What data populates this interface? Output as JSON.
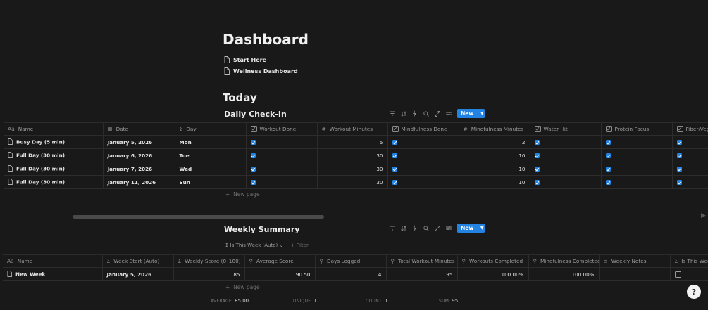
{
  "page": {
    "title": "Dashboard",
    "links": [
      "Start Here",
      "Wellness Dashboard"
    ],
    "section_title": "Today"
  },
  "daily": {
    "title": "Daily Check-In",
    "new_label": "New",
    "columns": {
      "name": "Name",
      "date": "Date",
      "day": "Day",
      "workout_done": "Workout Done",
      "workout_minutes": "Workout Minutes",
      "mindfulness_done": "Mindfulness Done",
      "mindfulness_minutes": "Mindfulness Minutes",
      "water_hit": "Water Hit",
      "protein_focus": "Protein Focus",
      "fiber_veg": "Fiber/Veg"
    },
    "rows": [
      {
        "name": "Busy Day (5 min)",
        "date": "January 5, 2026",
        "day": "Mon",
        "workout_minutes": "5",
        "mindfulness_minutes": "2"
      },
      {
        "name": "Full Day (30 min)",
        "date": "January 6, 2026",
        "day": "Tue",
        "workout_minutes": "30",
        "mindfulness_minutes": "10"
      },
      {
        "name": "Full Day (30 min)",
        "date": "January 7, 2026",
        "day": "Wed",
        "workout_minutes": "30",
        "mindfulness_minutes": "10"
      },
      {
        "name": "Full Day (30 min)",
        "date": "January 11, 2026",
        "day": "Sun",
        "workout_minutes": "30",
        "mindfulness_minutes": "10"
      }
    ],
    "new_page": "New page"
  },
  "weekly": {
    "title": "Weekly Summary",
    "new_label": "New",
    "filter_chip": "Is This Week (Auto)",
    "add_filter": "Filter",
    "columns": {
      "name": "Name",
      "week_start": "Week Start (Auto)",
      "weekly_score": "Weekly Score (0–100)",
      "average_score": "Average Score",
      "days_logged": "Days Logged",
      "total_workout": "Total Workout Minutes",
      "workouts_completed": "Workouts Completed",
      "mindfulness_completed": "Mindfulness Completed",
      "weekly_notes": "Weekly Notes",
      "is_this_week": "Is This Week"
    },
    "row": {
      "name": "New Week",
      "week_start": "January 5, 2026",
      "weekly_score": "85",
      "average_score": "90.50",
      "days_logged": "4",
      "total_workout": "95",
      "workouts_completed": "100.00%",
      "mindfulness_completed": "100.00%"
    },
    "new_page": "New page",
    "footer": {
      "average_label": "AVERAGE",
      "average_value": "85.00",
      "unique_label": "UNIQUE",
      "unique_value": "1",
      "count_label": "COUNT",
      "count_value": "1",
      "sum_label": "SUM",
      "sum_value": "95"
    }
  },
  "colors": {
    "background": "#191919",
    "accent": "#2383e2",
    "border": "#2c2c2c"
  },
  "icons": [
    "page-icon",
    "filter-icon",
    "sort-icon",
    "lightning-icon",
    "search-icon",
    "expand-icon",
    "settings-icon",
    "plus-icon",
    "help-icon"
  ]
}
